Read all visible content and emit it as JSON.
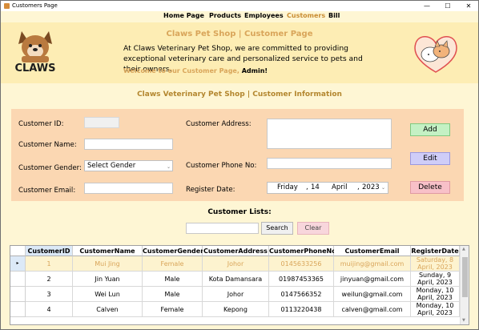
{
  "window": {
    "title": "Customers Page",
    "minimize": "—",
    "maximize": "☐",
    "close": "✕"
  },
  "menu": [
    "Home Page",
    "Products",
    "Employees",
    "Customers",
    "Bill"
  ],
  "header": {
    "title": "Claws Pet Shop",
    "separator": "|",
    "page": "Customer Page",
    "description": "At Claws Veterinary Pet Shop, we are committed to providing exceptional veterinary care and personalized service to pets and their owners.",
    "welcome": "Welcome to our Customer Page,",
    "user": "Admin!",
    "logo_text": "CLAWS"
  },
  "section": {
    "shop": "Claws Veterinary Pet Shop",
    "separator": "|",
    "title": "Customer Information"
  },
  "form": {
    "id_label": "Customer ID:",
    "id_value": "",
    "name_label": "Customer Name:",
    "name_value": "",
    "gender_label": "Customer Gender:",
    "gender_value": "Select Gender",
    "email_label": "Customer Email:",
    "email_value": "",
    "address_label": "Customer Address:",
    "address_value": "",
    "phone_label": "Customer Phone No:",
    "phone_value": "",
    "date_label": "Register Date:",
    "date_day": "Friday",
    "date_sep1": ",",
    "date_num": "14",
    "date_month": "April",
    "date_sep2": ",",
    "date_year": "2023"
  },
  "buttons": {
    "add": "Add",
    "edit": "Edit",
    "delete": "Delete",
    "search": "Search",
    "clear": "Clear"
  },
  "lists_title": "Customer Lists:",
  "search_value": "",
  "table": {
    "columns": [
      "CustomerID",
      "CustomerName",
      "CustomerGender",
      "CustomerAddress",
      "CustomerPhoneNo",
      "CustomerEmail",
      "RegisterDate"
    ],
    "rows": [
      [
        "1",
        "Mui Jing",
        "Female",
        "Johor",
        "0145633256",
        "muijing@gmail.com",
        "Saturday, 8 April, 2023"
      ],
      [
        "2",
        "Jin Yuan",
        "Male",
        "Kota Damansara",
        "01987453365",
        "jinyuan@gmail.com",
        "Sunday, 9 April, 2023"
      ],
      [
        "3",
        "Wei Lun",
        "Male",
        "Johor",
        "0147566352",
        "weilun@gmail.com",
        "Monday, 10 April, 2023"
      ],
      [
        "4",
        "Calven",
        "Female",
        "Kepong",
        "0113220438",
        "calven@gmail.com",
        "Monday, 10 April, 2023"
      ]
    ],
    "current_row_marker": "▸"
  },
  "colors": {
    "accent": "#d9a55a",
    "header_bg": "#fdedb4",
    "panel_bg": "#fbd7b2",
    "page_bg": "#fef6d4"
  }
}
